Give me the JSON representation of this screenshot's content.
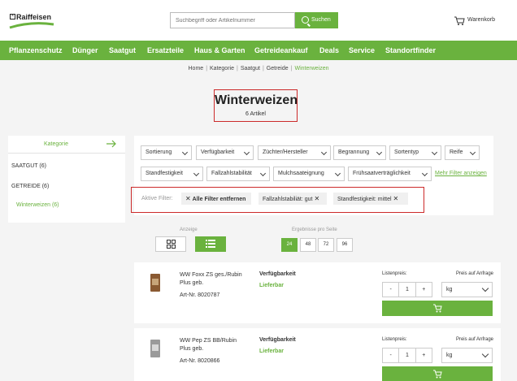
{
  "header": {
    "logo": "Raiffeisen",
    "search_placeholder": "Suchbegriff oder Artikelnummer",
    "search_button": "Suchen",
    "cart_label": "Warenkorb"
  },
  "nav": [
    "Pflanzenschutz",
    "Dünger",
    "Saatgut",
    "Ersatzteile",
    "Haus & Garten",
    "Getreideankauf",
    "Deals",
    "Service",
    "Standortfinder"
  ],
  "breadcrumb": [
    "Home",
    "Kategorie",
    "Saatgut",
    "Getreide",
    "Winterweizen"
  ],
  "page": {
    "title": "Winterweizen",
    "count": "6 Artikel"
  },
  "sidebar": {
    "heading": "Kategorie",
    "items": [
      "SAATGUT (6)",
      "GETREIDE (6)"
    ],
    "subitem": "Winterweizen (6)"
  },
  "filters": {
    "row1": [
      "Sortierung",
      "Verfügbarkeit",
      "Züchter/Hersteller",
      "Begrannung",
      "Sortentyp",
      "Reife"
    ],
    "row2": [
      "Standfestigkeit",
      "Fallzahlstabilität",
      "Mulchsaateignung",
      "Frühsaatverträglichkeit"
    ],
    "more": "Mehr Filter anzeigen",
    "active_label": "Aktive Filter:",
    "clear_all": "Alle Filter entfernen",
    "active": [
      "Fallzahlstabiliät: gut",
      "Standfestigkeit: mittel"
    ]
  },
  "view": {
    "label": "Anzeige",
    "per_page_label": "Ergebnisse pro Seite",
    "per_page": [
      "24",
      "48",
      "72",
      "96"
    ]
  },
  "products": [
    {
      "name": "WW Foxx ZS ges./Rubin Plus geb.",
      "art": "Art-Nr. 8020787",
      "avail_head": "Verfügbarkeit",
      "avail": "Lieferbar",
      "list_price": "Listenpreis:",
      "price_req": "Preis auf Anfrage",
      "qty": "1",
      "minus": "-",
      "plus": "+",
      "unit": "kg"
    },
    {
      "name": "WW Pep ZS BB/Rubin Plus geb.",
      "art": "Art-Nr. 8020866",
      "avail_head": "Verfügbarkeit",
      "avail": "Lieferbar",
      "list_price": "Listenpreis:",
      "price_req": "Preis auf Anfrage",
      "qty": "1",
      "minus": "-",
      "plus": "+",
      "unit": "kg"
    }
  ],
  "colors": {
    "brand_green": "#6ab23e",
    "highlight_red": "#cc2a2a"
  }
}
